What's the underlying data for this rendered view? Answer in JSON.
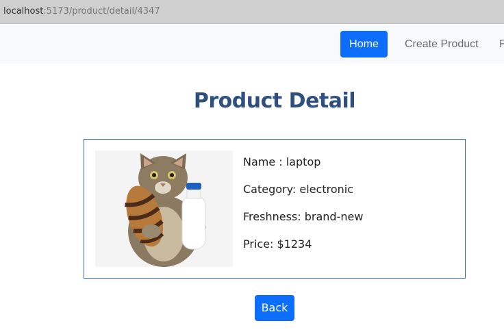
{
  "browser": {
    "url_host": "localhost",
    "url_path": ":5173/product/detail/4347"
  },
  "navbar": {
    "items": [
      {
        "label": "Home",
        "active": true
      },
      {
        "label": "Create Product",
        "active": false
      },
      {
        "label": "F",
        "active": false
      }
    ]
  },
  "page": {
    "title": "Product Detail"
  },
  "product": {
    "image_icon": "cat-with-croissant-and-milk",
    "name_line": "Name : laptop",
    "category_line": "Category: electronic",
    "freshness_line": "Freshness: brand-new",
    "price_line": "Price: $1234"
  },
  "actions": {
    "back_label": "Back"
  },
  "colors": {
    "primary": "#0d6efd",
    "title": "#2f4f7f",
    "card_border": "#2f6fb5"
  }
}
